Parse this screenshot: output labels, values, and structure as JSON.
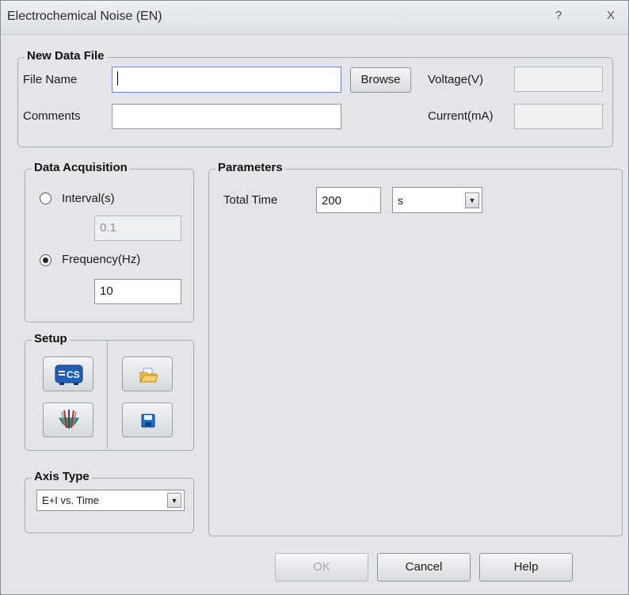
{
  "window": {
    "title": "Electrochemical Noise (EN)",
    "help_glyph": "?",
    "close_glyph": "X"
  },
  "new_data_file": {
    "legend": "New Data File",
    "file_name_label": "File Name",
    "file_name_value": "",
    "browse_label": "Browse",
    "voltage_label": "Voltage(V)",
    "voltage_value": "",
    "comments_label": "Comments",
    "comments_value": "",
    "current_label": "Current(mA)",
    "current_value": ""
  },
  "data_acquisition": {
    "legend": "Data Acquisition",
    "interval_label": "Interval(s)",
    "interval_value": "0.1",
    "interval_selected": false,
    "frequency_label": "Frequency(Hz)",
    "frequency_value": "10",
    "frequency_selected": true
  },
  "setup": {
    "legend": "Setup",
    "buttons": [
      {
        "icon": "cs-instrument-icon"
      },
      {
        "icon": "open-folder-icon"
      },
      {
        "icon": "electrode-icon"
      },
      {
        "icon": "save-disk-icon"
      }
    ]
  },
  "axis_type": {
    "legend": "Axis Type",
    "selected": "E+I vs. Time"
  },
  "parameters": {
    "legend": "Parameters",
    "total_time_label": "Total Time",
    "total_time_value": "200",
    "unit_selected": "s"
  },
  "footer": {
    "ok_label": "OK",
    "cancel_label": "Cancel",
    "help_label": "Help"
  }
}
